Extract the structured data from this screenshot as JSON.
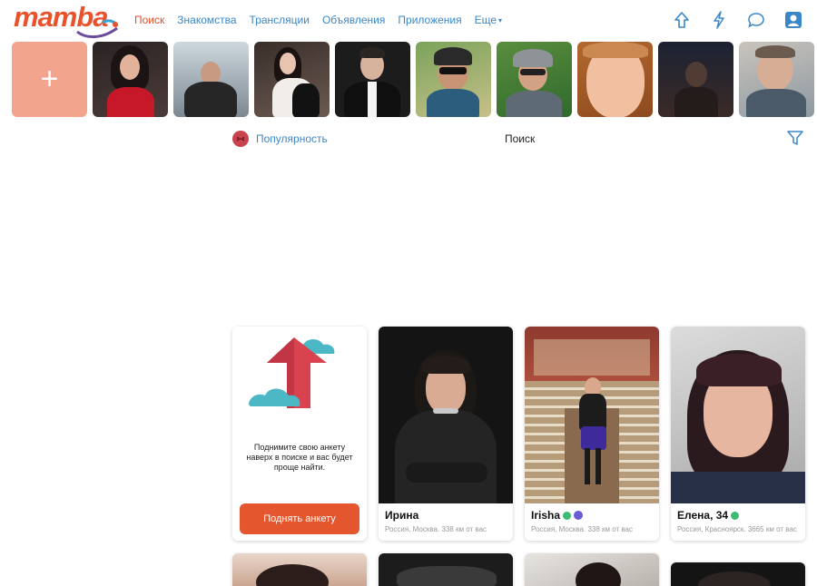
{
  "brand": {
    "logo_text": "mamba",
    "accent": "#e0502a",
    "link": "#3a87c8"
  },
  "nav": {
    "items": [
      {
        "label": "Поиск",
        "active": true
      },
      {
        "label": "Знакомства",
        "active": false
      },
      {
        "label": "Трансляции",
        "active": false
      },
      {
        "label": "Объявления",
        "active": false
      },
      {
        "label": "Приложения",
        "active": false
      },
      {
        "label": "Еще",
        "active": false
      }
    ]
  },
  "header_icons": [
    "raise-arrow-icon",
    "lightning-icon",
    "chat-bubble-icon",
    "profile-icon"
  ],
  "stories": {
    "add_symbol": "+",
    "count": 9
  },
  "filterbar": {
    "sort_label": "Популярность",
    "title": "Поиск"
  },
  "promo": {
    "text": "Поднимите свою анкету наверх в поиске и вас будет проще найти.",
    "button_label": "Поднять анкету"
  },
  "cards": [
    {
      "name": "Ирина",
      "online": false,
      "verified": false,
      "location": "Россия, Москва. 338 км от вас"
    },
    {
      "name": "Irisha",
      "online": true,
      "verified": true,
      "location": "Россия, Москва. 338 км от вас"
    },
    {
      "name": "Елена, 34",
      "online": true,
      "verified": false,
      "location": "Россия, Красноярск. 3665 км от вас"
    }
  ]
}
